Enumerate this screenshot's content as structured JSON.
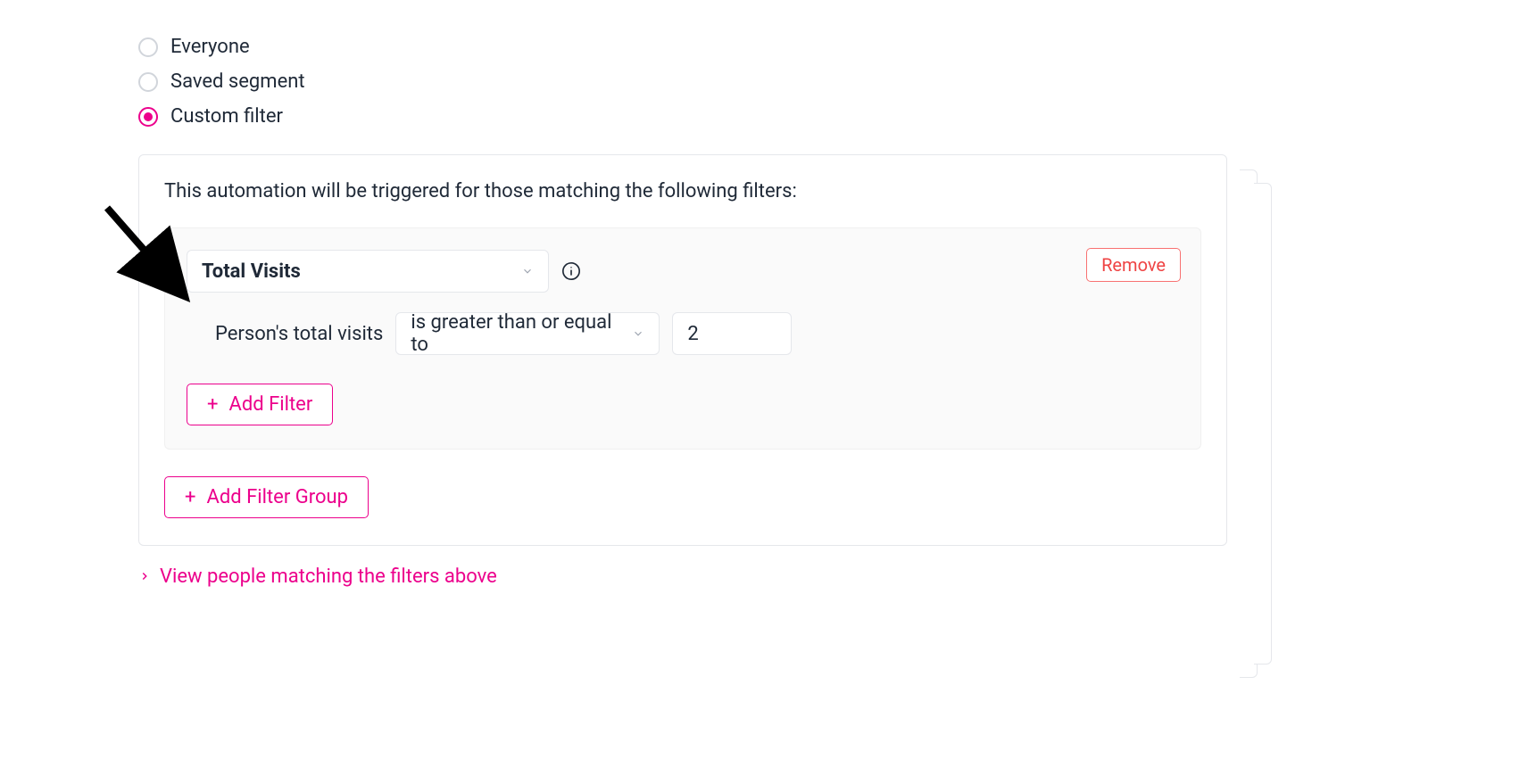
{
  "colors": {
    "accent": "#ec008c",
    "danger": "#ef4444"
  },
  "radios": {
    "everyone": "Everyone",
    "saved_segment": "Saved segment",
    "custom_filter": "Custom filter",
    "selected": "custom_filter"
  },
  "panel": {
    "description": "This automation will be triggered for those matching the following filters:"
  },
  "filter_group": {
    "field_select": "Total Visits",
    "remove_label": "Remove",
    "condition": {
      "label": "Person's total visits",
      "operator": "is greater than or equal to",
      "value": "2"
    },
    "add_filter_label": "Add Filter"
  },
  "add_filter_group_label": "Add Filter Group",
  "view_link_label": "View people matching the filters above"
}
